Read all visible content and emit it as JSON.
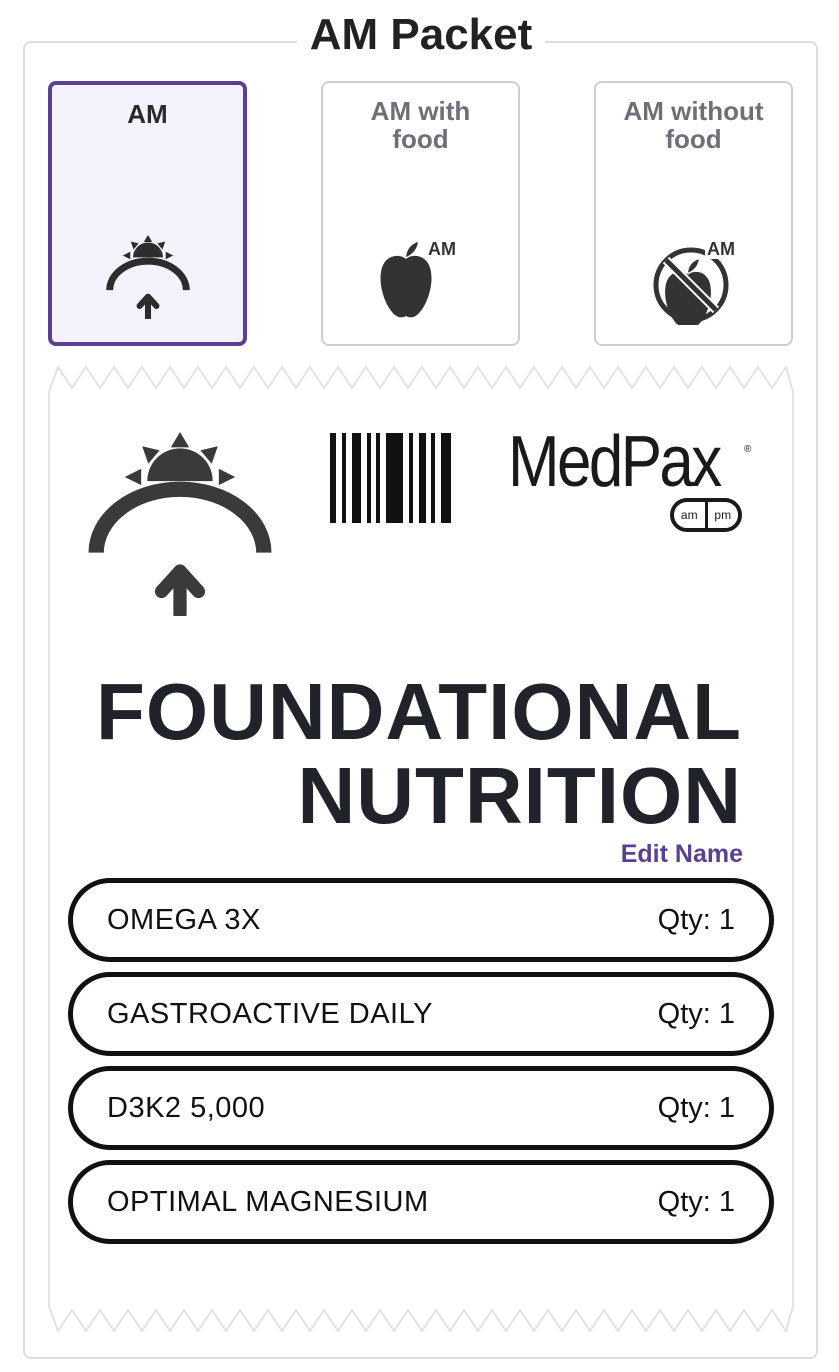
{
  "header": {
    "title": "AM Packet"
  },
  "options": [
    {
      "label_line1": "AM",
      "label_line2": "",
      "icon": "sunrise-icon",
      "selected": true
    },
    {
      "label_line1": "AM with",
      "label_line2": "food",
      "icon": "apple-am-icon",
      "selected": false
    },
    {
      "label_line1": "AM without",
      "label_line2": "food",
      "icon": "no-apple-am-icon",
      "selected": false
    }
  ],
  "icon_badges": {
    "am": "AM"
  },
  "packet": {
    "brand": "MedPax",
    "brand_reg": "®",
    "pill_left": "am",
    "pill_right": "pm",
    "name_line1": "FOUNDATIONAL",
    "name_line2": "NUTRITION",
    "edit_label": "Edit Name",
    "items": [
      {
        "name": "OMEGA 3X",
        "qty": "Qty: 1"
      },
      {
        "name": "GASTROACTIVE DAILY",
        "qty": "Qty: 1"
      },
      {
        "name": "D3K2 5,000",
        "qty": "Qty: 1"
      },
      {
        "name": "OPTIMAL MAGNESIUM",
        "qty": "Qty: 1"
      }
    ]
  },
  "colors": {
    "accent": "#5b3f92",
    "selected_bg": "#f3f2fd",
    "text_dark": "#20232a",
    "muted": "#6f6f7a"
  }
}
